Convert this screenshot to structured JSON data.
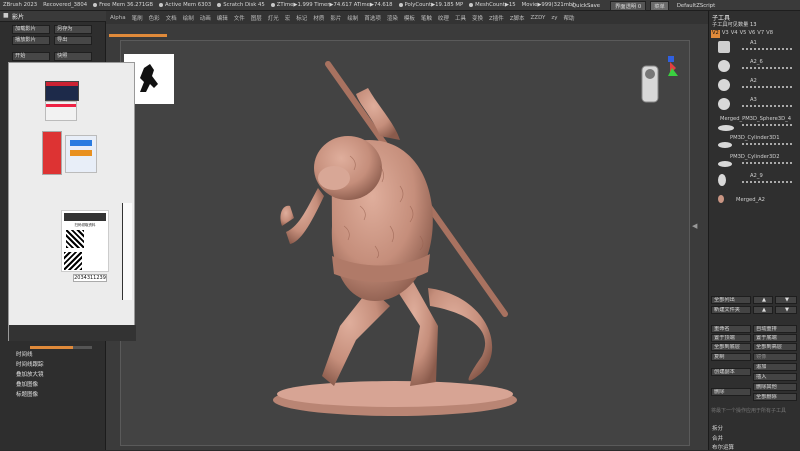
{
  "topbar": {
    "app": "ZBrush 2023",
    "doc": "Recovered_3804",
    "free_mem": "Free Mem 36.271GB",
    "active_mem": "Active Mem 6303",
    "scratch": "Scratch Disk 45",
    "ztime": "ZTime▶1.999 Timer▶74.617 ATime▶74.618",
    "polycount": "PolyCount▶19.185 MP",
    "meshcount": "MeshCount▶15",
    "movie": "Movie▶999(321mb)",
    "quicksave": "QuickSave",
    "transparency": "界面透明 0",
    "menu_btn": "菜单",
    "script": "DefaultZScript"
  },
  "menubar": [
    "Alpha",
    "笔刷",
    "色彩",
    "文档",
    "绘制",
    "动画",
    "编辑",
    "文件",
    "图层",
    "灯光",
    "宏",
    "标记",
    "材质",
    "影片",
    "绘制",
    "首选项",
    "渲染",
    "模板",
    "笔触",
    "纹理",
    "工具",
    "变换",
    "Z插件",
    "Z脚本",
    "ZZDY",
    "zy",
    "帮助"
  ],
  "leftpanel": {
    "title": "影片",
    "btn_load": "加载影片",
    "btn_saveas": "另存为",
    "btn_play": "播放影片",
    "btn_export": "导出",
    "btn_small1": "开始",
    "btn_small2": "快照",
    "timeline": "时间线",
    "timeline_track": "时间线跟踪",
    "overlay_zoom": "叠加放大镜",
    "overlay_image": "叠加图像",
    "title_image": "标题图像"
  },
  "popup": {
    "qr_title": "扫码领取资料",
    "id_text": "2034311239"
  },
  "rightpanel": {
    "title": "子工具",
    "subtitle": "子工具可见数量 13",
    "tabs": [
      "V2",
      "V3",
      "V4",
      "V5",
      "V6",
      "V7",
      "V8"
    ],
    "subtools": [
      "A1",
      "A2_6",
      "A2",
      "A3",
      "Merged_PM3D_Sphere3D_4",
      "PM3D_Cylinder3D1",
      "PM3D_Cylinder3D2",
      "A2_9",
      "Merged_A2"
    ],
    "list_all": "全部列出",
    "new_folder": "新建文件夹",
    "rename": "重命名",
    "auto_reorder": "自动重排",
    "move_top": "置于顶端",
    "move_bottom": "置于底端",
    "all_low": "全部到底层",
    "all_high": "全部到高层",
    "duplicate": "复制",
    "mirror": "镜像",
    "append": "追加",
    "create_copy": "创建副本",
    "insert": "插入",
    "delete_other": "删除其他",
    "delete": "删除",
    "delete_all": "全部删除",
    "hint": "将最下一个操作应用于所有子工具",
    "split": "拆分",
    "merge": "合并",
    "boolean": "布尔运算"
  },
  "colors": {
    "clay": "#c99583",
    "accent": "#e08a3a",
    "panel": "#2f2f2f"
  }
}
